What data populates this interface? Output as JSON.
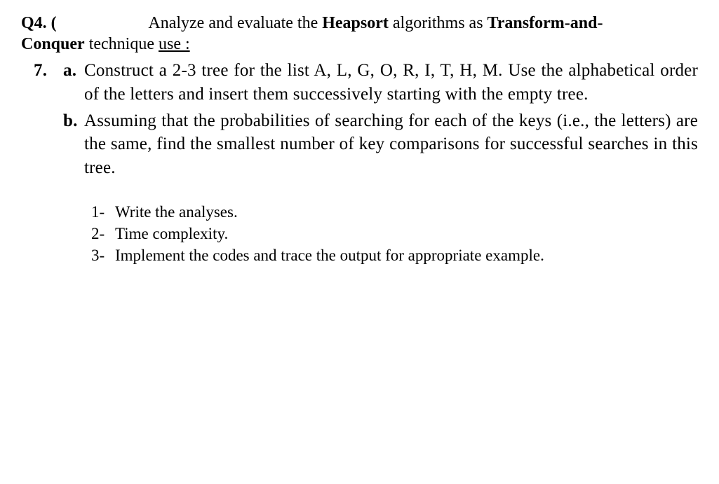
{
  "heading": {
    "qnum": "Q4. (",
    "lead_in": "Analyze and evaluate the ",
    "algoname": "Heapsort",
    "mid": " algorithms as ",
    "technique_a": "Transform-and-",
    "technique_b": "Conquer",
    "tail_a": " technique ",
    "tail_u": "use :"
  },
  "sub": {
    "num": "7.",
    "a_label": "a.",
    "a_text": "Construct a 2-3 tree for the list A, L, G, O, R, I, T, H, M. Use the alphabetical order of the letters and insert them successively starting with the empty tree.",
    "b_label": "b.",
    "b_text": "Assuming that the probabilities of searching for each of the keys (i.e., the letters) are the same, find the smallest number of key comparisons for successful searches in this tree."
  },
  "tasks": [
    {
      "n": "1-",
      "t": "Write the analyses."
    },
    {
      "n": "2-",
      "t": "Time complexity."
    },
    {
      "n": "3-",
      "t": "Implement the codes and trace the output for appropriate example."
    }
  ]
}
